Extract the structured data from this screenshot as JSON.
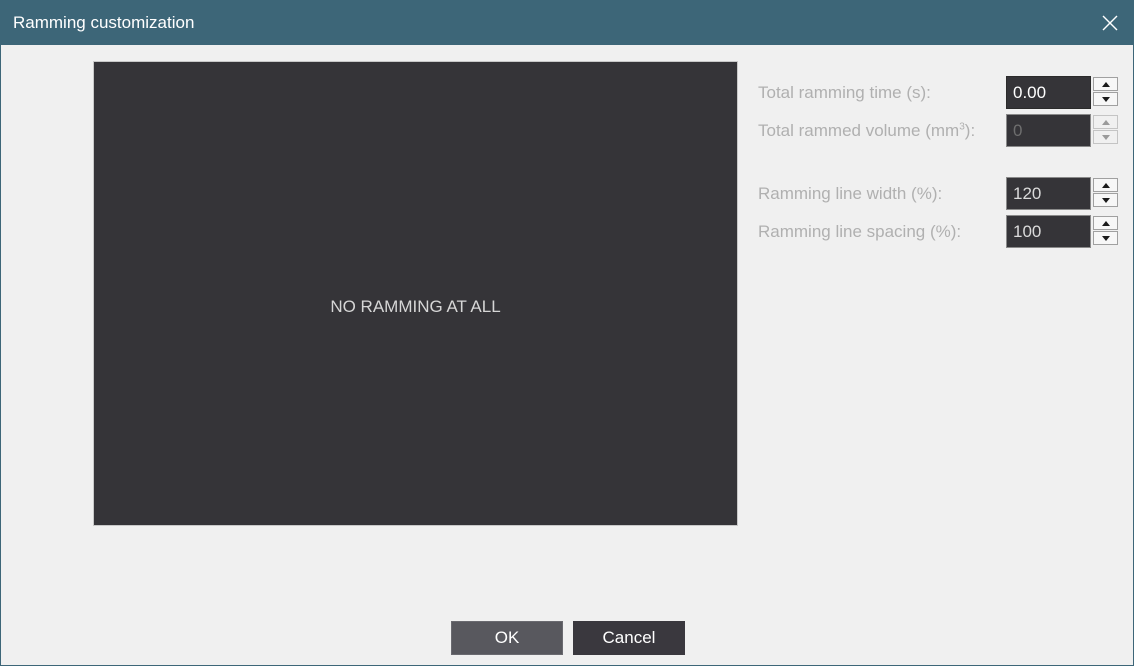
{
  "window": {
    "title": "Ramming customization",
    "close_icon": "close-icon"
  },
  "preview": {
    "message": "NO RAMMING AT ALL"
  },
  "fields": {
    "total_time": {
      "label": "Total ramming time (s):",
      "value": "0.00"
    },
    "total_volume": {
      "label_pre": "Total rammed volume (mm",
      "label_sup": "3",
      "label_post": "):",
      "value": "0"
    },
    "line_width": {
      "label": "Ramming line width (%):",
      "value": "120"
    },
    "line_spacing": {
      "label": "Ramming line spacing (%):",
      "value": "100"
    }
  },
  "buttons": {
    "ok": "OK",
    "cancel": "Cancel"
  },
  "colors": {
    "titlebar": "#3d6678",
    "preview_bg": "#353438",
    "ok_bg": "#58585e",
    "cancel_bg": "#3a383e"
  }
}
